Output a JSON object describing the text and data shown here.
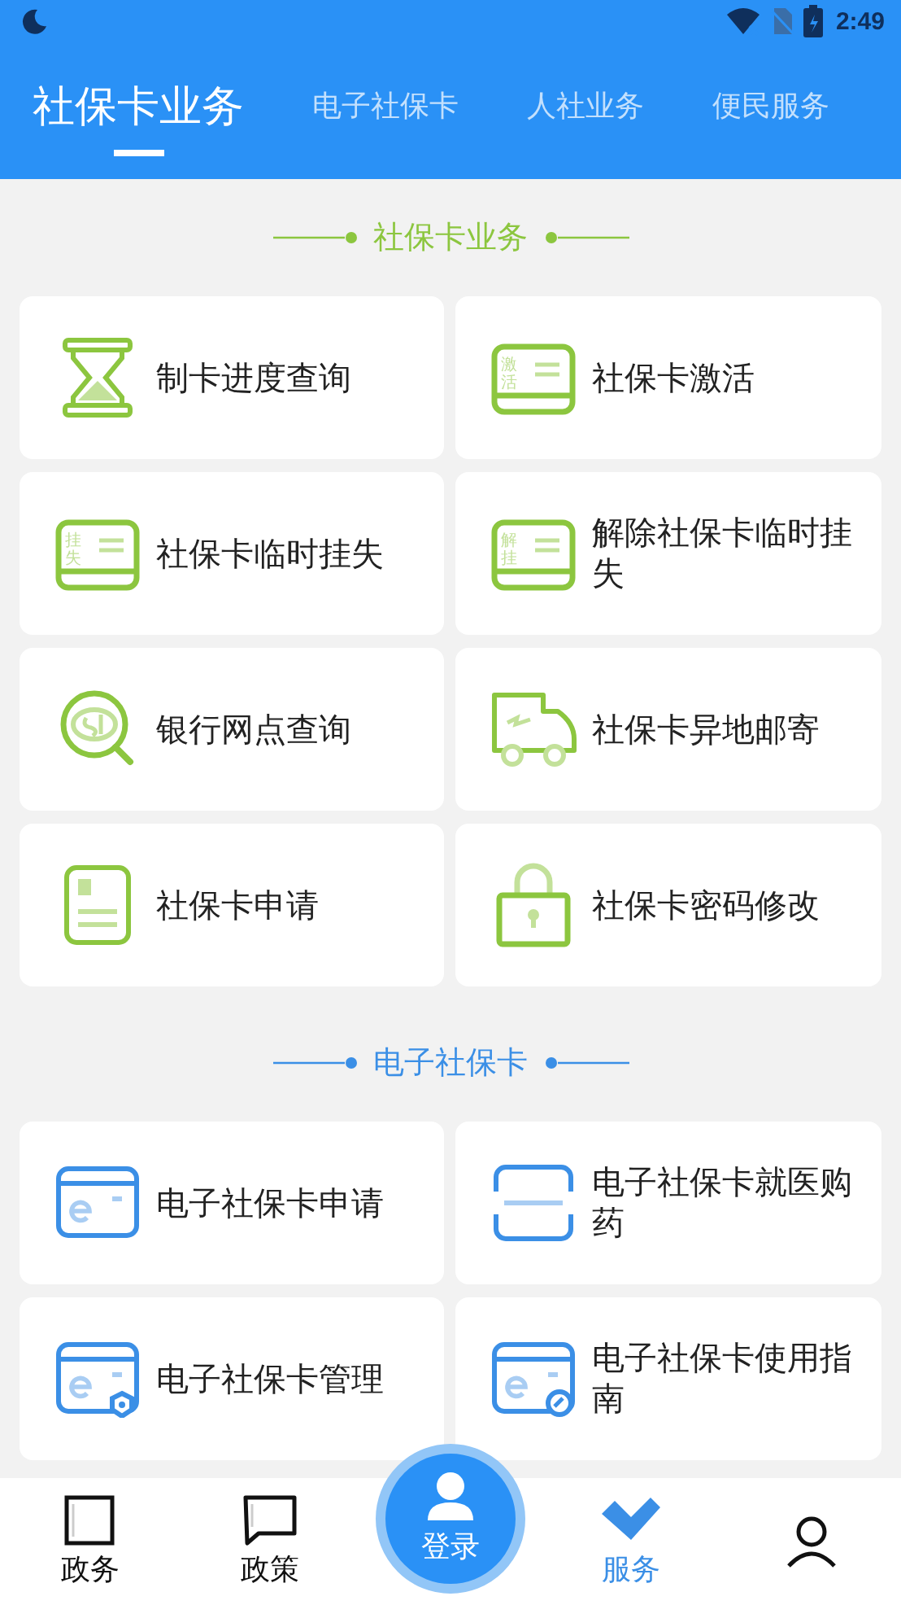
{
  "status_bar": {
    "time": "2:49"
  },
  "tabs": [
    {
      "label": "社保卡业务",
      "selected": true
    },
    {
      "label": "电子社保卡",
      "selected": false
    },
    {
      "label": "人社业务",
      "selected": false
    },
    {
      "label": "便民服务",
      "selected": false
    }
  ],
  "sections": [
    {
      "title": "社保卡业务",
      "color": "#8cc63f",
      "items": [
        {
          "label": "制卡进度查询"
        },
        {
          "label": "社保卡激活",
          "icon_text": "激活"
        },
        {
          "label": "社保卡临时挂失",
          "icon_text": "挂失"
        },
        {
          "label": "解除社保卡临时挂失",
          "icon_text": "解挂"
        },
        {
          "label": "银行网点查询"
        },
        {
          "label": "社保卡异地邮寄"
        },
        {
          "label": "社保卡申请"
        },
        {
          "label": "社保卡密码修改"
        }
      ]
    },
    {
      "title": "电子社保卡",
      "color": "#3b8fe6",
      "items": [
        {
          "label": "电子社保卡申请"
        },
        {
          "label": "电子社保卡就医购药"
        },
        {
          "label": "电子社保卡管理"
        },
        {
          "label": "电子社保卡使用指南"
        }
      ]
    }
  ],
  "nav": [
    {
      "kind": "tab",
      "label": "政务",
      "selected": false
    },
    {
      "kind": "tab",
      "label": "政策",
      "selected": false
    },
    {
      "kind": "center",
      "label": "登录"
    },
    {
      "kind": "tab",
      "label": "服务",
      "selected": true
    },
    {
      "kind": "tab",
      "selected": false
    }
  ]
}
